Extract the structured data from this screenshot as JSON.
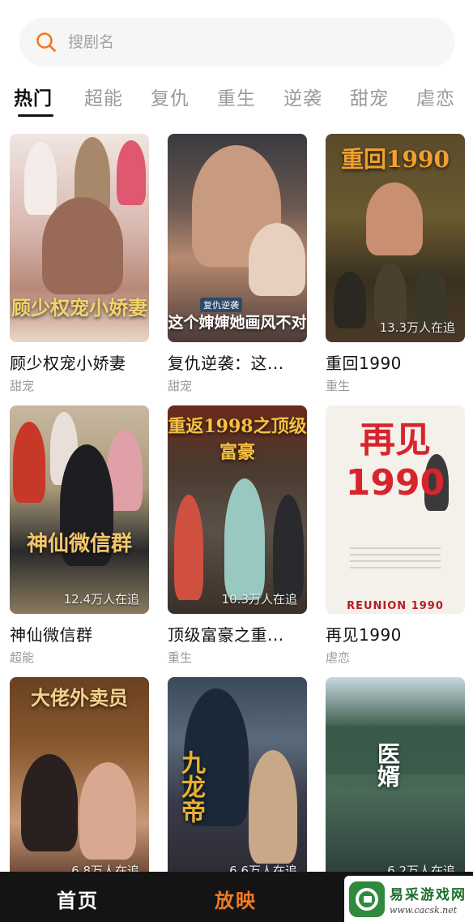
{
  "search": {
    "placeholder": "搜剧名"
  },
  "tabs": [
    "热门",
    "超能",
    "复仇",
    "重生",
    "逆袭",
    "甜宠",
    "虐恋"
  ],
  "dramas": [
    {
      "name": "顾少权宠小娇妻",
      "genre": "甜宠",
      "poster_title": "顾少权宠小娇妻",
      "views": ""
    },
    {
      "name": "复仇逆袭：这...",
      "genre": "甜宠",
      "poster_title": "这个婶婶她画风不对",
      "poster_subtitle": "复仇逆袭",
      "views": ""
    },
    {
      "name": "重回1990",
      "genre": "重生",
      "poster_title": "重回1990",
      "views": "13.3万人在追"
    },
    {
      "name": "神仙微信群",
      "genre": "超能",
      "poster_title": "神仙微信群",
      "views": "12.4万人在追"
    },
    {
      "name": "顶级富豪之重...",
      "genre": "重生",
      "poster_title": "重返1998之顶级富豪",
      "views": "10.3万人在追"
    },
    {
      "name": "再见1990",
      "genre": "虐恋",
      "poster_title": "再见1990",
      "poster_subtitle": "REUNION 1990",
      "views": ""
    },
    {
      "name": "",
      "genre": "",
      "poster_title": "大佬外卖员",
      "views": "6.8万人在追"
    },
    {
      "name": "",
      "genre": "",
      "poster_title": "九龙帝",
      "views": "6.6万人在追"
    },
    {
      "name": "",
      "genre": "",
      "poster_title": "医婿",
      "views": "6.2万人在追"
    }
  ],
  "bottom_nav": {
    "home": "首页",
    "play": "放映"
  },
  "watermark": {
    "name": "易采游戏网",
    "url": "www.cacsk.net"
  },
  "colors": {
    "accent": "#f07a22",
    "active_tab": "#111111",
    "inactive_tab": "#9a9a9a",
    "bottom_bar": "#141414"
  }
}
